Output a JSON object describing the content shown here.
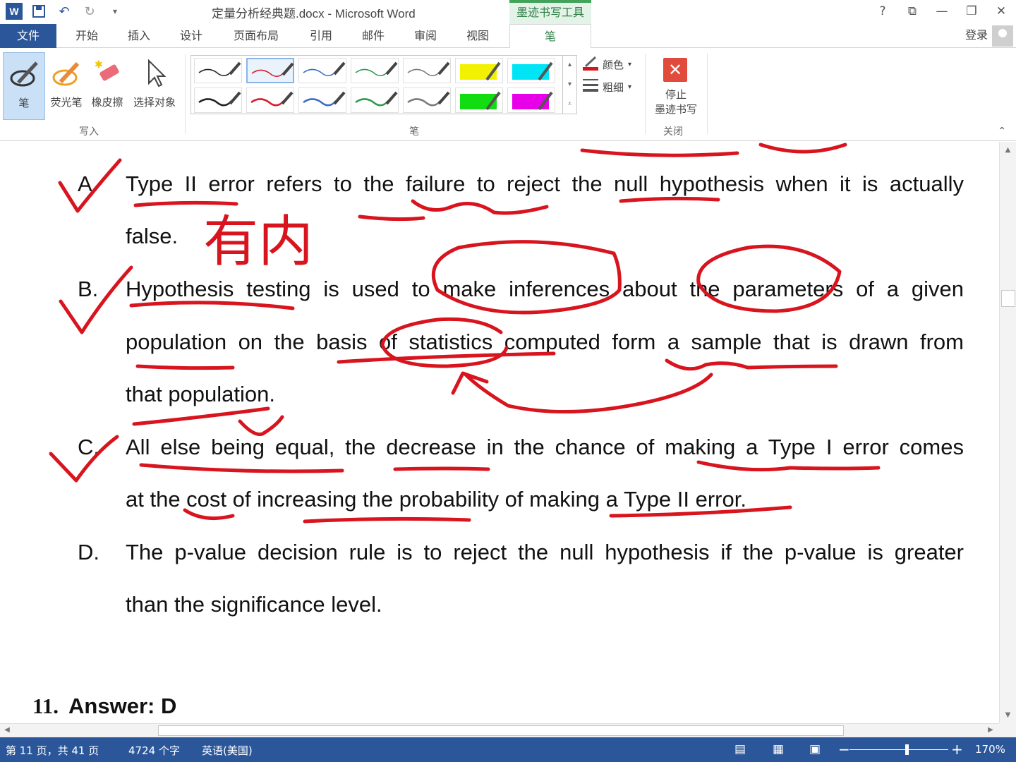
{
  "title_bar": {
    "doc_title": "定量分析经典题.docx - Microsoft Word",
    "context_tab": "墨迹书写工具",
    "app_icon": "W",
    "controls": [
      "?",
      "⧉",
      "—",
      "❐",
      "✕"
    ]
  },
  "tabs": {
    "file": "文件",
    "items": [
      "开始",
      "插入",
      "设计",
      "页面布局",
      "引用",
      "邮件",
      "审阅",
      "视图"
    ],
    "active": "笔",
    "login": "登录"
  },
  "ribbon": {
    "write_group": {
      "label": "写入",
      "tools": [
        {
          "label": "笔",
          "icon": "pen-icon"
        },
        {
          "label": "荧光笔",
          "icon": "highlighter-icon"
        },
        {
          "label": "橡皮擦",
          "icon": "eraser-icon"
        },
        {
          "label": "选择对象",
          "icon": "select-cursor-icon"
        }
      ]
    },
    "pens_group": {
      "label": "笔",
      "pen_colors": [
        "#222222",
        "#d81b2b",
        "#3a6ec0",
        "#2e9a4a",
        "#7a7a7a",
        "#f2f200",
        "#00e5f5",
        "#222222",
        "#d81b2b",
        "#3a6ec0",
        "#2e9a4a",
        "#7a7a7a",
        "#11dd11",
        "#e800e8"
      ],
      "color_label": "颜色",
      "weight_label": "粗细"
    },
    "close_group": {
      "label": "关闭",
      "stop_label_line1": "停止",
      "stop_label_line2": "墨迹书写"
    }
  },
  "document": {
    "options": [
      {
        "letter": "A.",
        "lines": [
          "Type II error refers to the failure to reject the null hypothesis when it is actually",
          "false."
        ]
      },
      {
        "letter": "B.",
        "lines": [
          "Hypothesis testing is used to make inferences about the parameters of a given",
          "population on the basis of statistics computed form a sample that is drawn from",
          "that population."
        ]
      },
      {
        "letter": "C.",
        "lines": [
          "All else being equal, the decrease in the chance of making a Type I error comes",
          "at the cost of increasing the probability of making a Type II error."
        ]
      },
      {
        "letter": "D.",
        "lines": [
          "The p-value decision rule is to reject the null hypothesis if the p-value is greater",
          "than the significance level."
        ]
      }
    ],
    "handwriting": "有内",
    "answer_number": "11.",
    "answer_text": "Answer: D",
    "ink_color": "#d8141e"
  },
  "status_bar": {
    "page": "第 11 页，共 41 页",
    "words": "4724 个字",
    "language": "英语(美国)",
    "zoom": "170%",
    "zoom_minus": "−",
    "zoom_plus": "+"
  }
}
